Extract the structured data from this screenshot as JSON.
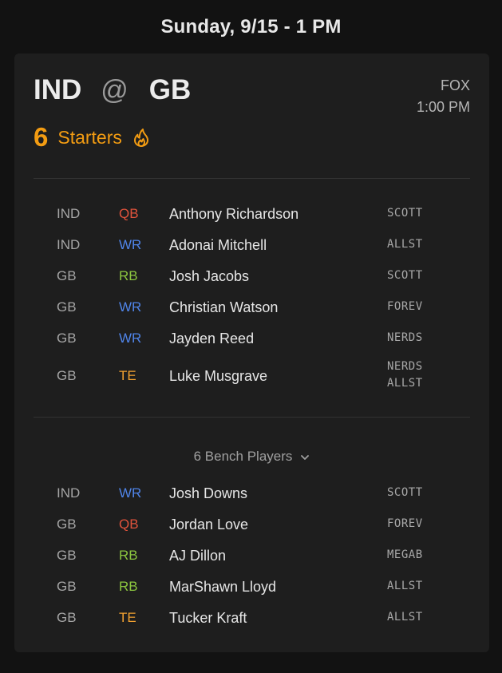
{
  "header": {
    "date": "Sunday, 9/15 - 1 PM"
  },
  "game": {
    "away": "IND",
    "at": "@",
    "home": "GB",
    "network": "FOX",
    "time": "1:00 PM",
    "starters_count": "6",
    "starters_label": "Starters",
    "icon": "flame-icon"
  },
  "colors": {
    "QB": "#e0533c",
    "WR": "#4f84e8",
    "RB": "#8cc63f",
    "TE": "#f0a030",
    "accent": "#f39c12"
  },
  "starters": [
    {
      "team": "IND",
      "pos": "QB",
      "name": "Anthony Richardson",
      "owners": [
        "SCOTT"
      ]
    },
    {
      "team": "IND",
      "pos": "WR",
      "name": "Adonai Mitchell",
      "owners": [
        "ALLST"
      ]
    },
    {
      "team": "GB",
      "pos": "RB",
      "name": "Josh Jacobs",
      "owners": [
        "SCOTT"
      ]
    },
    {
      "team": "GB",
      "pos": "WR",
      "name": "Christian Watson",
      "owners": [
        "FOREV"
      ]
    },
    {
      "team": "GB",
      "pos": "WR",
      "name": "Jayden Reed",
      "owners": [
        "NERDS"
      ]
    },
    {
      "team": "GB",
      "pos": "TE",
      "name": "Luke Musgrave",
      "owners": [
        "NERDS",
        "ALLST"
      ]
    }
  ],
  "bench": {
    "label": "6 Bench Players",
    "icon": "chevron-down-icon",
    "players": [
      {
        "team": "IND",
        "pos": "WR",
        "name": "Josh Downs",
        "owners": [
          "SCOTT"
        ]
      },
      {
        "team": "GB",
        "pos": "QB",
        "name": "Jordan Love",
        "owners": [
          "FOREV"
        ]
      },
      {
        "team": "GB",
        "pos": "RB",
        "name": "AJ Dillon",
        "owners": [
          "MEGAB"
        ]
      },
      {
        "team": "GB",
        "pos": "RB",
        "name": "MarShawn Lloyd",
        "owners": [
          "ALLST"
        ]
      },
      {
        "team": "GB",
        "pos": "TE",
        "name": "Tucker Kraft",
        "owners": [
          "ALLST"
        ]
      }
    ]
  }
}
